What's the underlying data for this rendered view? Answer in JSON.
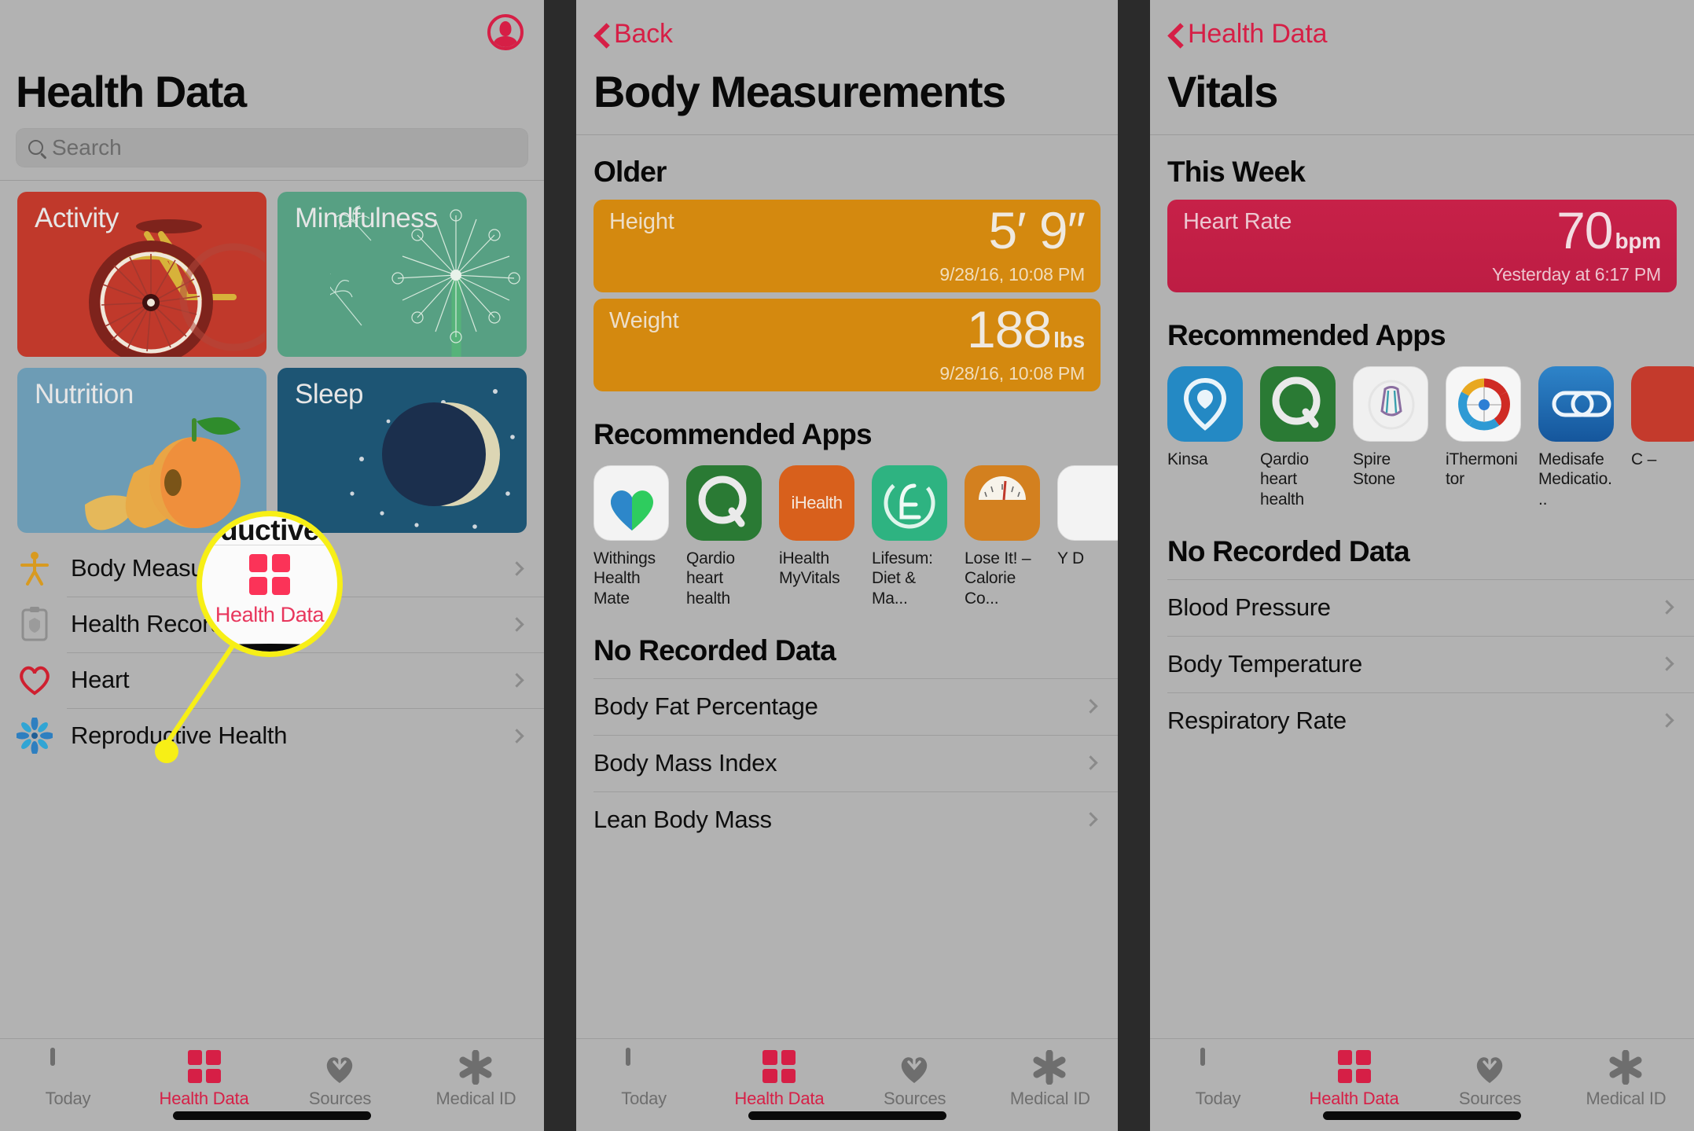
{
  "panels": {
    "health_data": {
      "title": "Health Data",
      "profile_icon": "profile-icon",
      "search_placeholder": "Search",
      "tiles": [
        {
          "label": "Activity",
          "color": "#c0392b",
          "icon": "bicycle-icon"
        },
        {
          "label": "Mindfulness",
          "color": "#57a083",
          "icon": "dandelion-icon"
        },
        {
          "label": "Nutrition",
          "color": "#6d9cb5",
          "icon": "peach-icon"
        },
        {
          "label": "Sleep",
          "color": "#1d5574",
          "icon": "moon-icon"
        }
      ],
      "rows": [
        {
          "label": "Body Measurements",
          "icon": "body-figure-icon"
        },
        {
          "label": "Health Records",
          "icon": "clipboard-icon"
        },
        {
          "label": "Heart",
          "icon": "heart-icon"
        },
        {
          "label": "Reproductive Health",
          "icon": "flower-icon"
        }
      ]
    },
    "body_measurements": {
      "back_label": "Back",
      "title": "Body Measurements",
      "section_older": "Older",
      "cards": [
        {
          "label": "Height",
          "value": "5′ 9″",
          "unit": "",
          "timestamp": "9/28/16, 10:08 PM",
          "color": "#d4890f"
        },
        {
          "label": "Weight",
          "value": "188",
          "unit": "lbs",
          "timestamp": "9/28/16, 10:08 PM",
          "color": "#d4890f"
        }
      ],
      "section_apps": "Recommended Apps",
      "apps": [
        {
          "name": "Withings Health Mate",
          "icon": "withings-heart-icon"
        },
        {
          "name": "Qardio heart health",
          "icon": "qardio-q-icon"
        },
        {
          "name": "iHealth MyVitals",
          "icon": "ihealth-icon"
        },
        {
          "name": "Lifesum: Diet & Ma...",
          "icon": "lifesum-icon"
        },
        {
          "name": "Lose It! – Calorie Co...",
          "icon": "loseit-scale-icon"
        },
        {
          "name": "Y D",
          "icon": "partial-app-icon"
        }
      ],
      "section_norecord": "No Recorded Data",
      "no_record_rows": [
        "Body Fat Percentage",
        "Body Mass Index",
        "Lean Body Mass"
      ]
    },
    "vitals": {
      "back_label": "Health Data",
      "title": "Vitals",
      "section_week": "This Week",
      "cards": [
        {
          "label": "Heart Rate",
          "value": "70",
          "unit": "bpm",
          "timestamp": "Yesterday at 6:17 PM",
          "color": "#c72148"
        }
      ],
      "section_apps": "Recommended Apps",
      "apps": [
        {
          "name": "Kinsa",
          "icon": "kinsa-pin-icon"
        },
        {
          "name": "Qardio heart health",
          "icon": "qardio-q-icon"
        },
        {
          "name": "Spire Stone",
          "icon": "spire-stone-icon"
        },
        {
          "name": "iThermonitor",
          "icon": "ithermonitor-dial-icon"
        },
        {
          "name": "Medisafe Medicatio...",
          "icon": "medisafe-pill-icon"
        },
        {
          "name": "C –",
          "icon": "partial-app-icon"
        }
      ],
      "section_norecord": "No Recorded Data",
      "no_record_rows": [
        "Blood Pressure",
        "Body Temperature",
        "Respiratory Rate"
      ]
    }
  },
  "tabbar": {
    "tabs": [
      {
        "label": "Today",
        "icon": "calculator-icon",
        "active": false
      },
      {
        "label": "Health Data",
        "icon": "health-data-grid-icon",
        "active": true
      },
      {
        "label": "Sources",
        "icon": "heart-arrow-icon",
        "active": false
      },
      {
        "label": "Medical ID",
        "icon": "asterisk-icon",
        "active": false
      }
    ]
  },
  "callout": {
    "partial_text": "ductive",
    "label": "Health Data",
    "icon": "health-data-grid-icon",
    "highlight_color": "#f7ef16",
    "label_color": "#e8365c"
  },
  "colors": {
    "accent_red": "#d61f46",
    "screen_bg": "#b2b2b2",
    "separator_bg": "#2b2b2b"
  }
}
